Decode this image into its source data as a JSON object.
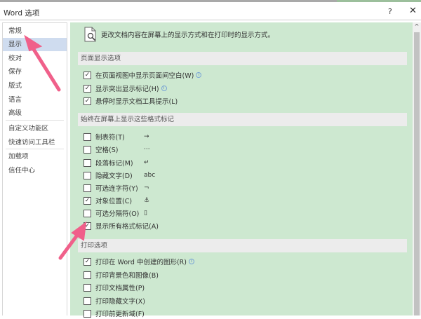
{
  "window": {
    "title": "Word 选项",
    "help": "?",
    "close": "✕"
  },
  "sidebar": {
    "items": [
      {
        "label": "常规"
      },
      {
        "label": "显示",
        "selected": true
      },
      {
        "label": "校对"
      },
      {
        "label": "保存"
      },
      {
        "label": "版式"
      },
      {
        "label": "语言"
      },
      {
        "label": "高级"
      },
      {
        "label": "自定义功能区"
      },
      {
        "label": "快速访问工具栏"
      },
      {
        "label": "加载项"
      },
      {
        "label": "信任中心"
      }
    ]
  },
  "main": {
    "intro": "更改文档内容在屏幕上的显示方式和在打印时的显示方式。",
    "sections": [
      {
        "title": "页面显示选项",
        "rows": [
          {
            "label": "在页面视图中显示页面间空白(W)",
            "checked": true,
            "info": true
          },
          {
            "label": "显示突出显示标记(H)",
            "checked": true,
            "info": true
          },
          {
            "label": "悬停时显示文档工具提示(L)",
            "checked": true
          }
        ]
      },
      {
        "title": "始终在屏幕上显示这些格式标记",
        "rows": [
          {
            "label": "制表符(T)",
            "checked": false,
            "symbol": "→"
          },
          {
            "label": "空格(S)",
            "checked": false,
            "symbol": "···"
          },
          {
            "label": "段落标记(M)",
            "checked": false,
            "symbol": "↵"
          },
          {
            "label": "隐藏文字(D)",
            "checked": false,
            "symbol": "abc"
          },
          {
            "label": "可选连字符(Y)",
            "checked": false,
            "symbol": "¬"
          },
          {
            "label": "对象位置(C)",
            "checked": true,
            "symbol": "⚓"
          },
          {
            "label": "可选分隔符(O)",
            "checked": false,
            "symbol": "▯"
          },
          {
            "label": "显示所有格式标记(A)",
            "checked": true
          }
        ]
      },
      {
        "title": "打印选项",
        "rows": [
          {
            "label": "打印在 Word 中创建的图形(R)",
            "checked": true,
            "info": true
          },
          {
            "label": "打印背景色和图像(B)",
            "checked": false
          },
          {
            "label": "打印文档属性(P)",
            "checked": false
          },
          {
            "label": "打印隐藏文字(X)",
            "checked": false
          },
          {
            "label": "打印前更新域(F)",
            "checked": false
          }
        ]
      }
    ]
  },
  "colors": {
    "panel": "#cde8d0",
    "selected": "#cfdcef",
    "arrow": "#f0608a"
  }
}
